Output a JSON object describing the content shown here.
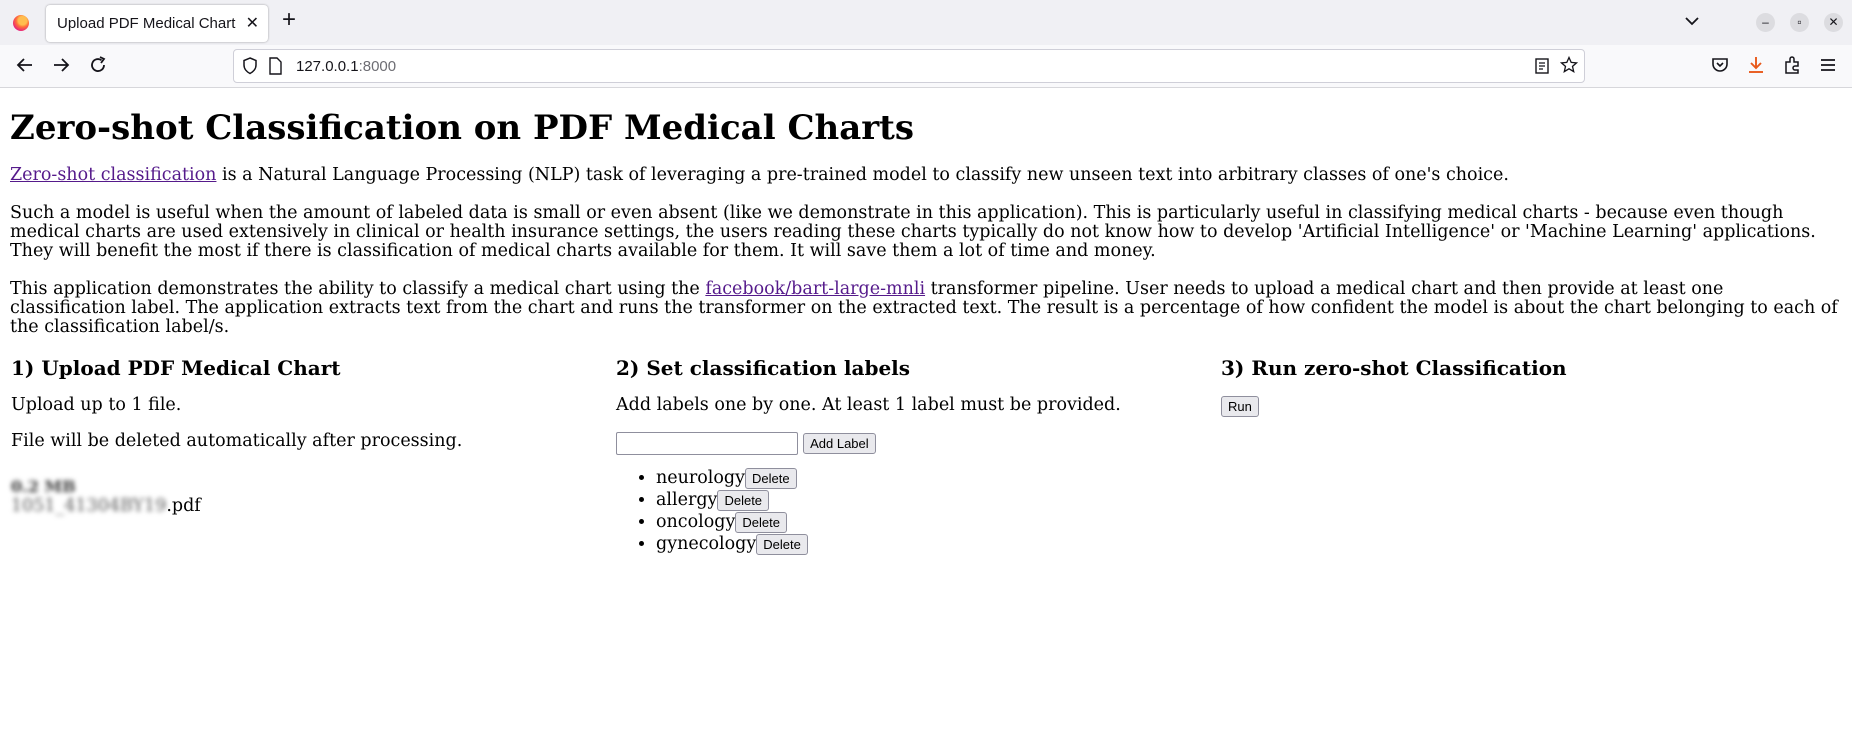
{
  "browser": {
    "tab_title": "Upload PDF Medical Chart",
    "url_host": "127.0.0.1",
    "url_port": ":8000"
  },
  "page": {
    "title": "Zero-shot Classification on PDF Medical Charts",
    "intro_link": "Zero-shot classification",
    "intro_rest": " is a Natural Language Processing (NLP) task of leveraging a pre-trained model to classify new unseen text into arbitrary classes of one's choice.",
    "para2": "Such a model is useful when the amount of labeled data is small or even absent (like we demonstrate in this application). This is particularly useful in classifying medical charts - because even though medical charts are used extensively in clinical or health insurance settings, the users reading these charts typically do not know how to develop 'Artificial Intelligence' or 'Machine Learning' applications. They will benefit the most if there is classification of medical charts available for them. It will save them a lot of time and money.",
    "para3_pre": "This application demonstrates the ability to classify a medical chart using the ",
    "para3_link": "facebook/bart-large-mnli",
    "para3_post": " transformer pipeline. User needs to upload a medical chart and then provide at least one classification label. The application extracts text from the chart and runs the transformer on the extracted text. The result is a percentage of how confident the model is about the chart belonging to each of the classification label/s."
  },
  "upload": {
    "heading": "1) Upload PDF Medical Chart",
    "limit_text": "Upload up to 1 file.",
    "delete_note": "File will be deleted automatically after processing.",
    "file_size": "0.2 MB",
    "file_name_blurred": "1051_41304BY19",
    "file_ext": ".pdf"
  },
  "labels": {
    "heading": "2) Set classification labels",
    "instruction": "Add labels one by one. At least 1 label must be provided.",
    "input_value": "",
    "add_button": "Add Label",
    "delete_button": "Delete",
    "items": [
      "neurology",
      "allergy",
      "oncology",
      "gynecology"
    ]
  },
  "run": {
    "heading": "3) Run zero-shot Classification",
    "button": "Run"
  }
}
